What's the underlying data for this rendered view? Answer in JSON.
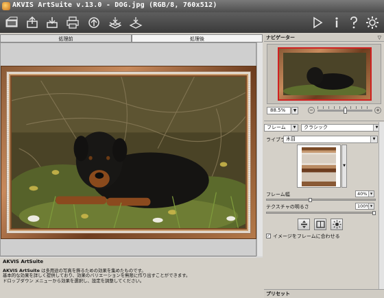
{
  "window": {
    "title": "AKVIS ArtSuite v.13.0 - DOG.jpg (RGB/8, 760x512)"
  },
  "toolbar": {
    "left_buttons": [
      "open-image-icon",
      "open-icon",
      "save-icon",
      "print-icon",
      "share-icon",
      "batch-icon",
      "presets-icon"
    ],
    "right_buttons": [
      "run-icon",
      "info-icon",
      "help-icon",
      "settings-icon"
    ]
  },
  "tabs": {
    "before": "処理前",
    "after": "処理後"
  },
  "navigator": {
    "title": "ナビゲーター",
    "zoom_value": "88.5%"
  },
  "settings": {
    "category": "フレーム",
    "frame_style": "クラシック",
    "library_label": "ライブラリ",
    "library_value": "木目",
    "frame_width_label": "フレーム幅",
    "frame_width_value": "40%",
    "frame_width_fraction": 0.4,
    "brightness_label": "テクスチャの明るさ",
    "brightness_value": "100%",
    "brightness_fraction": 1.0,
    "fit_checkbox_label": "イメージをフレームに合わせる",
    "fit_checked": true
  },
  "presets": {
    "title": "プリセット"
  },
  "description": {
    "title": "AKVIS ArtSuite",
    "line1_bold": "AKVIS ArtSuite",
    "line1_rest": " は多用途の写真を飾るための効果を集めたものです。",
    "line2": "基本的な効果を詳しく提供しており、効果のバリエーションを無限に作り出すことができます。",
    "line3": "ドロップダウン メニューから効果を選択し、設定を調整してください。"
  }
}
